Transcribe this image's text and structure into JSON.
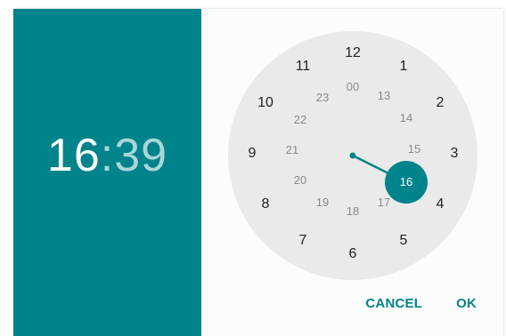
{
  "time": {
    "hour": "16",
    "separator": ":",
    "minute": "39"
  },
  "clock": {
    "selected": "16",
    "outer_numbers": [
      "12",
      "1",
      "2",
      "3",
      "4",
      "5",
      "6",
      "7",
      "8",
      "9",
      "10",
      "11"
    ],
    "inner_numbers": [
      "00",
      "13",
      "14",
      "15",
      "16",
      "17",
      "18",
      "19",
      "20",
      "21",
      "22",
      "23"
    ]
  },
  "actions": {
    "cancel": "CANCEL",
    "ok": "OK"
  },
  "colors": {
    "accent": "#00838a",
    "header_bg": "#00838a",
    "clock_face": "#eaeaea"
  }
}
